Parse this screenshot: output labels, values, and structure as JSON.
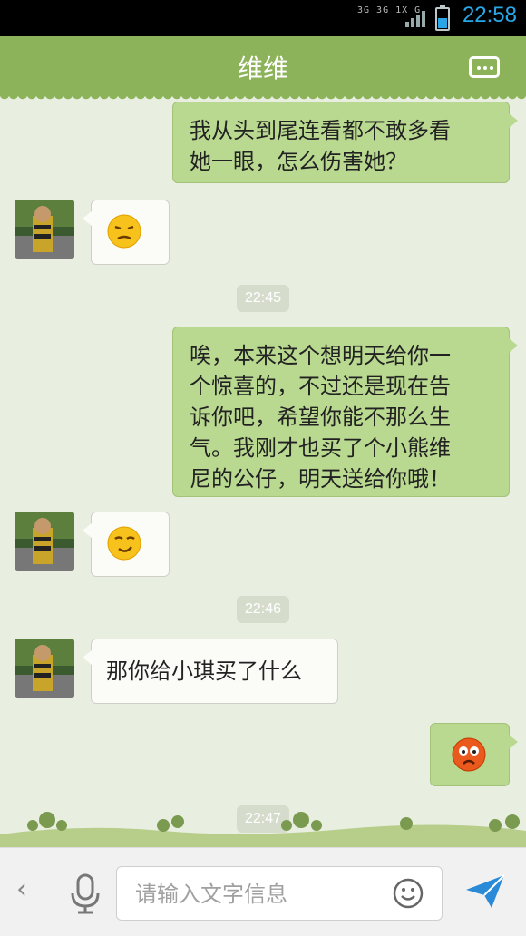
{
  "status_bar": {
    "network": "3G 3G 1X G",
    "time": "22:58"
  },
  "header": {
    "title": "维维",
    "menu_icon": "more-icon"
  },
  "messages": [
    {
      "type": "text",
      "direction": "outgoing",
      "lines": [
        "我从头到尾连看都不敢多看",
        "她一眼，怎么伤害她？"
      ]
    },
    {
      "type": "emoji",
      "direction": "incoming",
      "emoji": "pout-emoji"
    },
    {
      "type": "timestamp",
      "text": "22:45"
    },
    {
      "type": "text",
      "direction": "outgoing",
      "lines": [
        "唉，本来这个想明天给你一",
        "个惊喜的，不过还是现在告",
        "诉你吧，希望你能不那么生",
        "气。我刚才也买了个小熊维",
        "尼的公仔，明天送给你哦！"
      ]
    },
    {
      "type": "emoji",
      "direction": "incoming",
      "emoji": "smug-emoji"
    },
    {
      "type": "timestamp",
      "text": "22:46"
    },
    {
      "type": "text",
      "direction": "incoming",
      "lines": [
        "那你给小琪买了什么"
      ]
    },
    {
      "type": "emoji",
      "direction": "outgoing",
      "emoji": "angry-emoji"
    },
    {
      "type": "timestamp",
      "text": "22:47"
    }
  ],
  "input_bar": {
    "placeholder": "请输入文字信息"
  },
  "colors": {
    "header_green": "#8cb35a",
    "outgoing_bubble": "#b9d890",
    "clock_blue": "#28a8e8",
    "send_blue": "#2a8ad8"
  }
}
